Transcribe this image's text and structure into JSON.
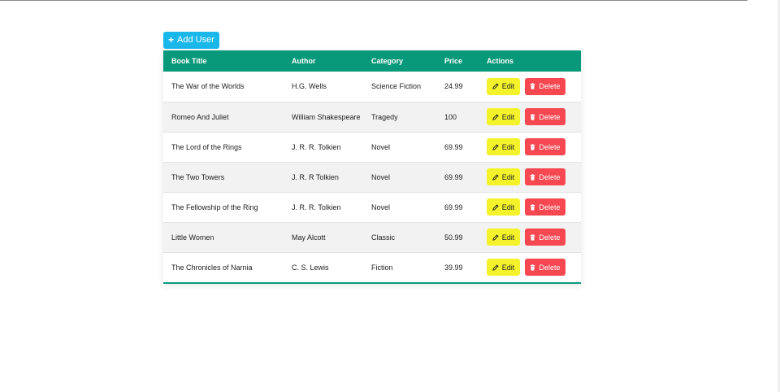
{
  "toolbar": {
    "add_user_label": "Add User",
    "add_user_icon": "plus-icon"
  },
  "table": {
    "headers": [
      "Book Title",
      "Author",
      "Category",
      "Price",
      "Actions"
    ],
    "edit_label": "Edit",
    "delete_label": "Delete",
    "edit_icon": "pencil-icon",
    "delete_icon": "trash-icon",
    "rows": [
      {
        "title": "The War of the Worlds",
        "author": "H.G. Wells",
        "category": "Science Fiction",
        "price": "24.99"
      },
      {
        "title": "Romeo And Juliet",
        "author": "William Shakespeare",
        "category": "Tragedy",
        "price": "100"
      },
      {
        "title": "The Lord of the Rings",
        "author": "J. R. R. Tolkien",
        "category": "Novel",
        "price": "69.99"
      },
      {
        "title": "The Two Towers",
        "author": "J. R. R Tolkien",
        "category": "Novel",
        "price": "69.99"
      },
      {
        "title": "The Fellowship of the Ring",
        "author": "J. R. R. Tolkien",
        "category": "Novel",
        "price": "69.99"
      },
      {
        "title": "Little Women",
        "author": "May Alcott",
        "category": "Classic",
        "price": "50.99"
      },
      {
        "title": "The Chronicles of Narnia",
        "author": "C. S. Lewis",
        "category": "Fiction",
        "price": "39.99"
      }
    ]
  },
  "colors": {
    "header_bg": "#08987a",
    "add_button": "#1ab7ea",
    "edit_button": "#f4f32b",
    "delete_button": "#f74750"
  }
}
